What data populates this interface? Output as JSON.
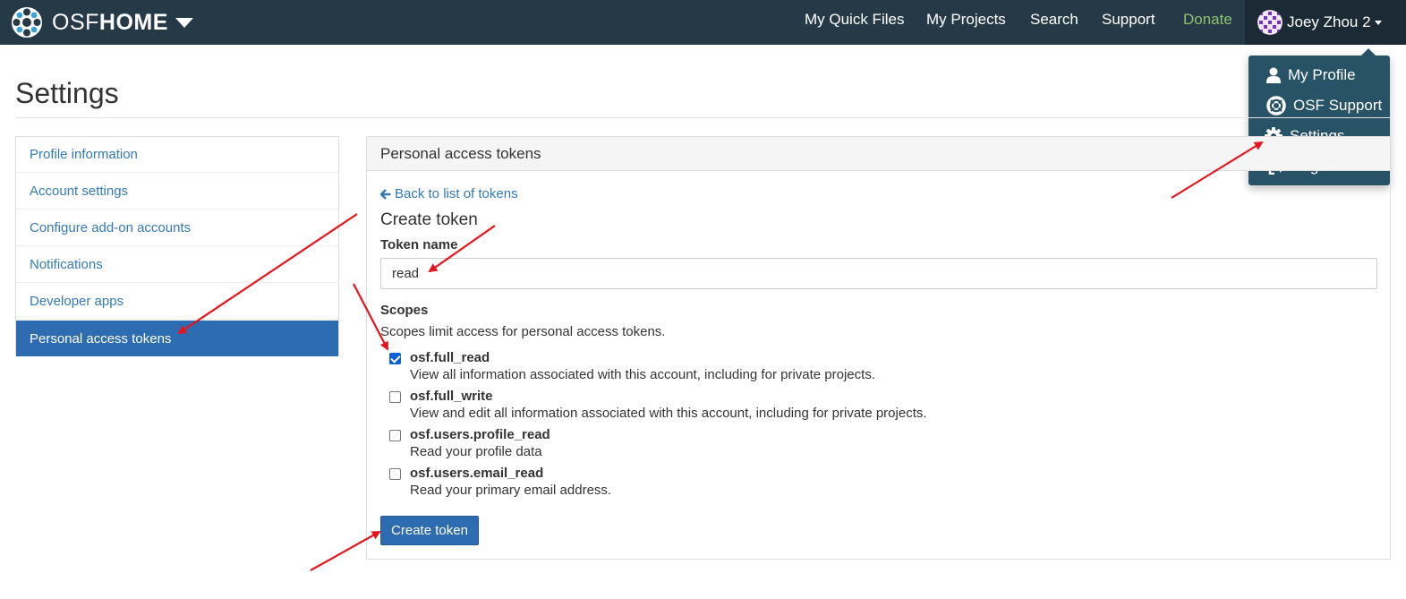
{
  "navbar": {
    "brand_osf": "OSF",
    "brand_home": "HOME",
    "links": {
      "quick_files": "My Quick Files",
      "projects": "My Projects",
      "search": "Search",
      "support": "Support",
      "donate": "Donate"
    },
    "user_name": "Joey Zhou 2",
    "donate_color": "#8ec26d",
    "bg_color": "#263947"
  },
  "dropdown": {
    "items": [
      {
        "label": "My Profile",
        "icon": "user-icon"
      },
      {
        "label": "OSF Support",
        "icon": "life-ring-icon"
      },
      {
        "label": "Settings",
        "icon": "gear-icon"
      },
      {
        "label": "Log Out",
        "icon": "sign-out-icon"
      }
    ]
  },
  "page": {
    "title": "Settings"
  },
  "sidebar": {
    "items": [
      {
        "label": "Profile information"
      },
      {
        "label": "Account settings"
      },
      {
        "label": "Configure add-on accounts"
      },
      {
        "label": "Notifications"
      },
      {
        "label": "Developer apps"
      },
      {
        "label": "Personal access tokens",
        "active": true
      }
    ],
    "active_color": "#2d6cb1"
  },
  "panel": {
    "heading": "Personal access tokens",
    "back_link": "Back to list of tokens",
    "create_title": "Create token",
    "token_name_label": "Token name",
    "token_name_value": "read",
    "scopes_label": "Scopes",
    "scopes_help": "Scopes limit access for personal access tokens.",
    "scopes": [
      {
        "name": "osf.full_read",
        "desc": "View all information associated with this account, including for private projects.",
        "checked": true
      },
      {
        "name": "osf.full_write",
        "desc": "View and edit all information associated with this account, including for private projects.",
        "checked": false
      },
      {
        "name": "osf.users.profile_read",
        "desc": "Read your profile data",
        "checked": false
      },
      {
        "name": "osf.users.email_read",
        "desc": "Read your primary email address.",
        "checked": false
      }
    ],
    "submit_label": "Create token"
  },
  "annotation_color": "#e8141b"
}
